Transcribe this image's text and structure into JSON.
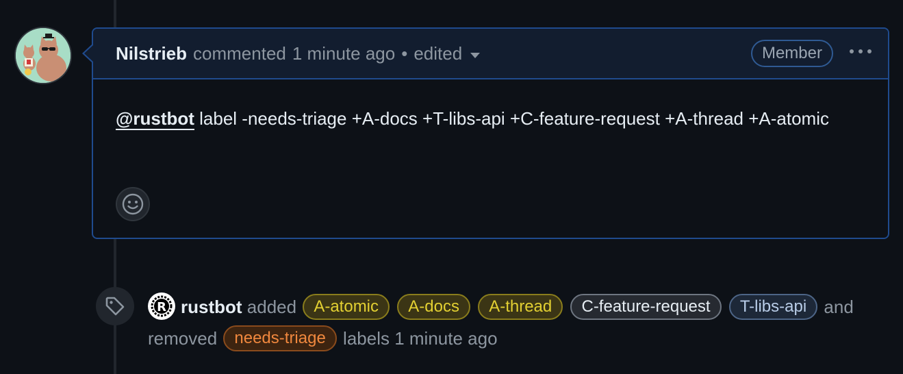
{
  "comment": {
    "author": "Nilstrieb",
    "action": "commented",
    "timestamp": "1 minute ago",
    "separator": "•",
    "edited_label": "edited",
    "role_badge": "Member",
    "menu_icon": "kebab-horizontal-icon",
    "mention": "@rustbot",
    "body_text": " label -needs-triage +A-docs +T-libs-api +C-feature-request +A-thread +A-atomic",
    "reaction_icon": "smiley-icon"
  },
  "event": {
    "icon": "tag-icon",
    "actor": "rustbot",
    "added_text": "added",
    "added_labels": [
      {
        "name": "A-atomic",
        "color": "#e3d032",
        "bg": "#3b3515",
        "border": "#8a7d1c"
      },
      {
        "name": "A-docs",
        "color": "#e3d032",
        "bg": "#3b3515",
        "border": "#8a7d1c"
      },
      {
        "name": "A-thread",
        "color": "#e3d032",
        "bg": "#3b3515",
        "border": "#8a7d1c"
      },
      {
        "name": "C-feature-request",
        "color": "#e6edf3",
        "bg": "#262a31",
        "border": "#6e7681"
      },
      {
        "name": "T-libs-api",
        "color": "#b9cde8",
        "bg": "#1d2838",
        "border": "#4d6587"
      }
    ],
    "and_text": "and",
    "removed_text": "removed",
    "removed_labels": [
      {
        "name": "needs-triage",
        "color": "#f0883e",
        "bg": "#3d2410",
        "border": "#8a4b1c"
      }
    ],
    "labels_text": "labels",
    "timestamp": "1 minute ago"
  },
  "colors": {
    "background": "#0d1117",
    "accent_border": "#1f4b8e",
    "muted": "#8d96a0"
  }
}
